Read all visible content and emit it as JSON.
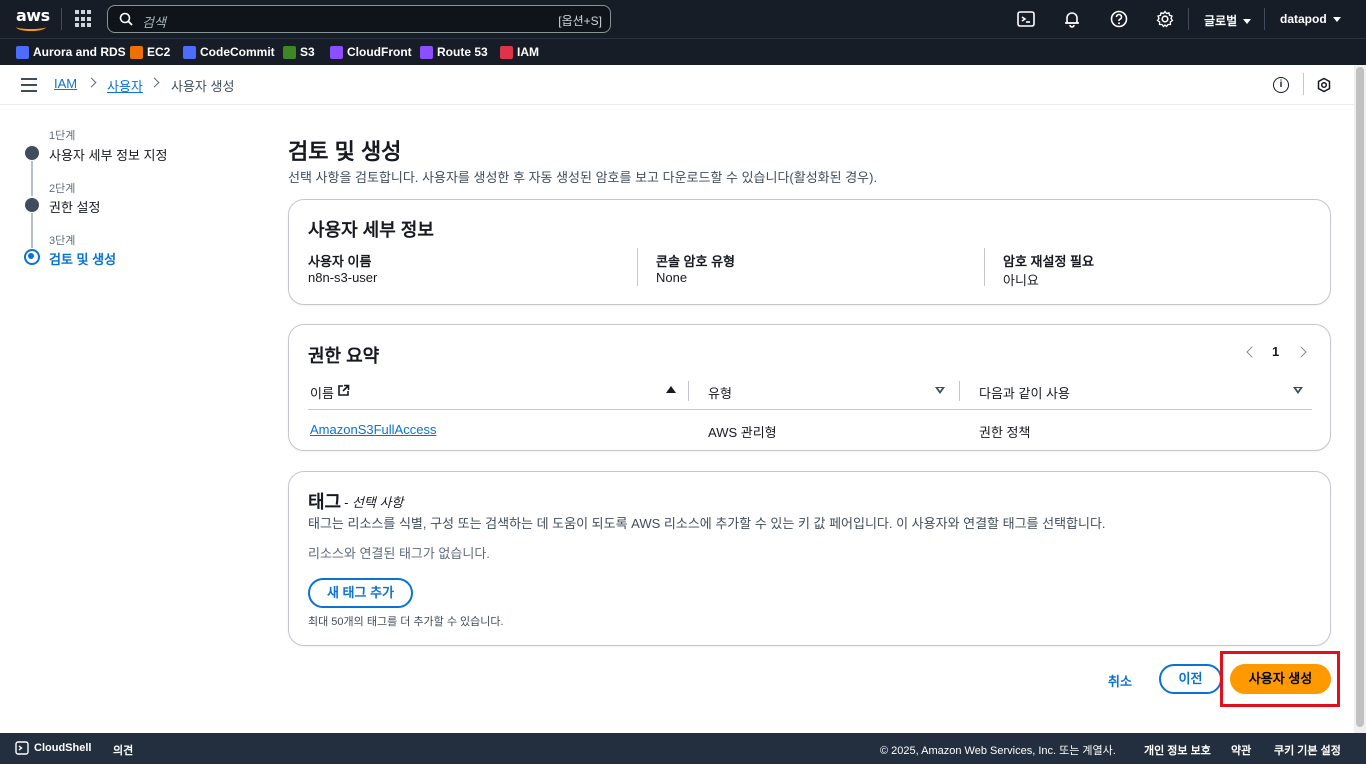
{
  "topbar": {
    "logo_text": "aws",
    "search_placeholder": "검색",
    "search_shortcut": "[옵션+S]",
    "region": "글로벌",
    "account": "datapod"
  },
  "favorites": [
    {
      "label": "Aurora and RDS",
      "color": "#4d6bfe"
    },
    {
      "label": "EC2",
      "color": "#ed7100"
    },
    {
      "label": "CodeCommit",
      "color": "#4d6bfe"
    },
    {
      "label": "S3",
      "color": "#3f8624"
    },
    {
      "label": "CloudFront",
      "color": "#8c4fff"
    },
    {
      "label": "Route 53",
      "color": "#8c4fff"
    },
    {
      "label": "IAM",
      "color": "#dd344c"
    }
  ],
  "breadcrumb": {
    "items": [
      "IAM",
      "사용자",
      "사용자 생성"
    ]
  },
  "steps": [
    {
      "label": "1단계",
      "title": "사용자 세부 정보 지정"
    },
    {
      "label": "2단계",
      "title": "권한 설정"
    },
    {
      "label": "3단계",
      "title": "검토 및 생성"
    }
  ],
  "main": {
    "title": "검토 및 생성",
    "description": "선택 사항을 검토합니다. 사용자를 생성한 후 자동 생성된 암호를 보고 다운로드할 수 있습니다(활성화된 경우)."
  },
  "user_details": {
    "heading": "사용자 세부 정보",
    "fields": [
      {
        "key": "사용자 이름",
        "value": "n8n-s3-user"
      },
      {
        "key": "콘솔 암호 유형",
        "value": "None"
      },
      {
        "key": "암호 재설정 필요",
        "value": "아니요"
      }
    ]
  },
  "permissions": {
    "heading": "권한 요약",
    "page": "1",
    "columns": [
      "이름",
      "유형",
      "다음과 같이 사용"
    ],
    "rows": [
      {
        "name": "AmazonS3FullAccess",
        "type": "AWS 관리형",
        "used_as": "권한 정책"
      }
    ]
  },
  "tags": {
    "heading": "태그",
    "optional": "- 선택 사항",
    "description": "태그는 리소스를 식별, 구성 또는 검색하는 데 도움이 되도록 AWS 리소스에 추가할 수 있는 키 값 페어입니다. 이 사용자와 연결할 태그를 선택합니다.",
    "empty": "리소스와 연결된 태그가 없습니다.",
    "add_button": "새 태그 추가",
    "limit_note": "최대 50개의 태그를 더 추가할 수 있습니다."
  },
  "actions": {
    "cancel": "취소",
    "previous": "이전",
    "create": "사용자 생성"
  },
  "footer": {
    "cloudshell": "CloudShell",
    "feedback": "의견",
    "copyright": "© 2025, Amazon Web Services, Inc. 또는 계열사.",
    "privacy": "개인 정보 보호",
    "terms": "약관",
    "cookies": "쿠키 기본 설정"
  }
}
